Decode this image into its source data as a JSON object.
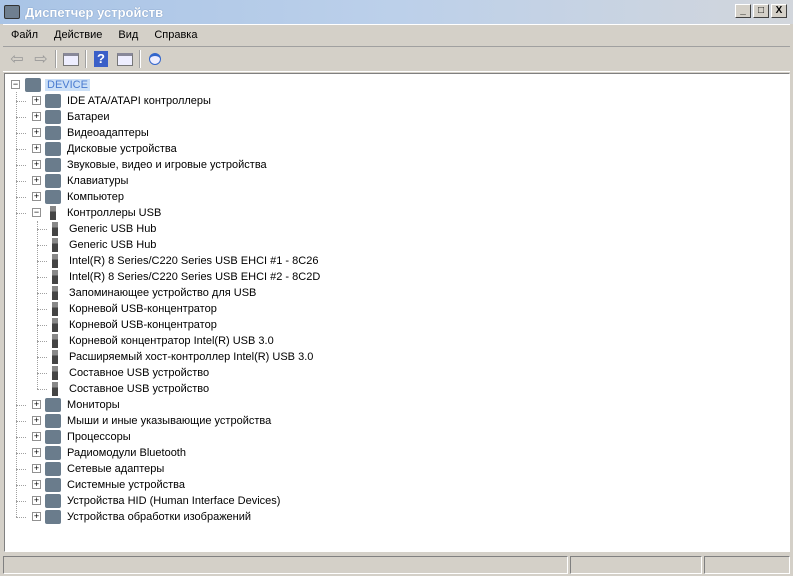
{
  "window": {
    "title": "Диспетчер устройств",
    "min": "_",
    "max": "□",
    "close": "X"
  },
  "menu": [
    "Файл",
    "Действие",
    "Вид",
    "Справка"
  ],
  "toolbar": {
    "icons": [
      "back-arrow-icon",
      "forward-arrow-icon",
      "console-tree-icon",
      "help-icon",
      "action-pane-icon",
      "scan-hardware-icon"
    ],
    "help_glyph": "?"
  },
  "tree": {
    "root": "DEVICE",
    "categories": [
      {
        "label": "IDE ATA/ATAPI контроллеры",
        "expanded": false,
        "icon": "ide-controller-icon"
      },
      {
        "label": "Батареи",
        "expanded": false,
        "icon": "battery-icon"
      },
      {
        "label": "Видеоадаптеры",
        "expanded": false,
        "icon": "display-adapter-icon"
      },
      {
        "label": "Дисковые устройства",
        "expanded": false,
        "icon": "disk-drive-icon"
      },
      {
        "label": "Звуковые, видео и игровые устройства",
        "expanded": false,
        "icon": "speaker-icon"
      },
      {
        "label": "Клавиатуры",
        "expanded": false,
        "icon": "keyboard-icon"
      },
      {
        "label": "Компьютер",
        "expanded": false,
        "icon": "computer-icon"
      },
      {
        "label": "Контроллеры USB",
        "expanded": true,
        "icon": "usb-icon",
        "children": [
          "Generic USB Hub",
          "Generic USB Hub",
          "Intel(R) 8 Series/C220 Series USB EHCI #1 - 8C26",
          "Intel(R) 8 Series/C220 Series USB EHCI #2 - 8C2D",
          "Запоминающее устройство для USB",
          "Корневой USB-концентратор",
          "Корневой USB-концентратор",
          "Корневой концентратор Intel(R) USB 3.0",
          "Расширяемый хост-контроллер Intel(R) USB 3.0",
          "Составное USB устройство",
          "Составное USB устройство"
        ]
      },
      {
        "label": "Мониторы",
        "expanded": false,
        "icon": "monitor-icon"
      },
      {
        "label": "Мыши и иные указывающие устройства",
        "expanded": false,
        "icon": "mouse-icon"
      },
      {
        "label": "Процессоры",
        "expanded": false,
        "icon": "processor-icon"
      },
      {
        "label": "Радиомодули Bluetooth",
        "expanded": false,
        "icon": "bluetooth-icon"
      },
      {
        "label": "Сетевые адаптеры",
        "expanded": false,
        "icon": "network-adapter-icon"
      },
      {
        "label": "Системные устройства",
        "expanded": false,
        "icon": "system-device-icon"
      },
      {
        "label": "Устройства HID (Human Interface Devices)",
        "expanded": false,
        "icon": "hid-icon"
      },
      {
        "label": "Устройства обработки изображений",
        "expanded": false,
        "icon": "camera-icon"
      }
    ]
  },
  "colors": {
    "selection_bg": "#cce0f7",
    "selection_text": "#4a7bd0"
  }
}
